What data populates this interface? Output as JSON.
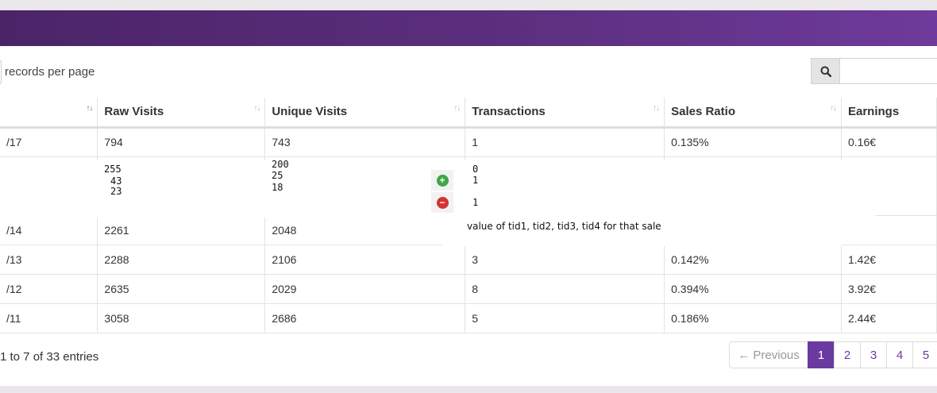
{
  "toolbar": {
    "length_label": "records per page",
    "search_icon": "search-icon",
    "search_value": ""
  },
  "table": {
    "headers": [
      {
        "label": "",
        "sort": "desc"
      },
      {
        "label": "Raw Visits",
        "sort": "none"
      },
      {
        "label": "Unique Visits",
        "sort": "none"
      },
      {
        "label": "Transactions",
        "sort": "none"
      },
      {
        "label": "Sales Ratio",
        "sort": "none"
      },
      {
        "label": "Earnings",
        "sort": "none"
      }
    ],
    "rows": [
      [
        "/17",
        "794",
        "743",
        "1",
        "0.135%",
        "0.16€"
      ],
      [
        "",
        "",
        "",
        "",
        "",
        ""
      ],
      [
        "/14",
        "2261",
        "2048",
        "",
        "",
        ""
      ],
      [
        "/13",
        "2288",
        "2106",
        "3",
        "0.142%",
        "1.42€"
      ],
      [
        "/12",
        "2635",
        "2029",
        "8",
        "0.394%",
        "3.92€"
      ],
      [
        "/11",
        "3058",
        "2686",
        "5",
        "0.186%",
        "2.44€"
      ]
    ]
  },
  "detail": {
    "raw": [
      "255",
      "43",
      "23"
    ],
    "unique": [
      "200",
      "25",
      "18"
    ],
    "transactions": [
      "0",
      "1",
      "1"
    ],
    "expand_icon": "plus-circle-icon",
    "collapse_icon": "minus-circle-icon",
    "note": "value of tid1, tid2, tid3, tid4 for that sale"
  },
  "footer": {
    "info": "1 to 7 of 33 entries",
    "prev_label": "← Previous",
    "pages": [
      "1",
      "2",
      "3",
      "4",
      "5"
    ],
    "current_page": "1"
  },
  "colors": {
    "header_start": "#4b2468",
    "header_end": "#6e3a9c",
    "accent": "#6a3aa0"
  }
}
